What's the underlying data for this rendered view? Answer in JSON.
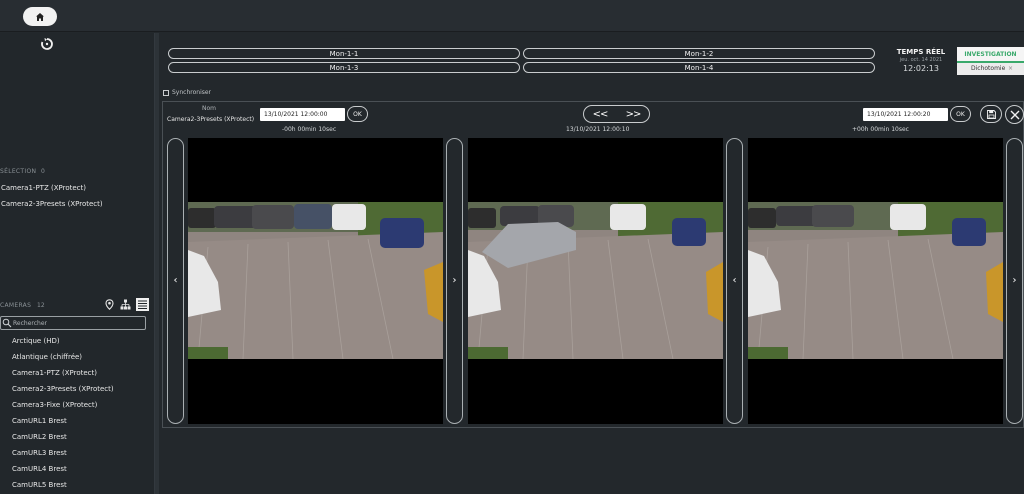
{
  "topbar": {
    "home_icon": "home-icon"
  },
  "sidebar": {
    "reset_icon": "reset-icon",
    "selection": {
      "label": "SÉLECTION",
      "count": "0",
      "items": [
        "Camera1-PTZ (XProtect)",
        "Camera2-3Presets (XProtect)"
      ]
    },
    "cameras": {
      "label": "CAMERAS",
      "count": "12",
      "tool_icons": [
        "map-pin-icon",
        "tree-icon",
        "list-icon"
      ],
      "search_placeholder": "Rechercher",
      "items": [
        "Arctique (HD)",
        "Atlantique (chiffrée)",
        "Camera1-PTZ (XProtect)",
        "Camera2-3Presets (XProtect)",
        "Camera3-Fixe (XProtect)",
        "CamURL1 Brest",
        "CamURL2 Brest",
        "CamURL3 Brest",
        "CamURL4 Brest",
        "CamURL5 Brest"
      ]
    }
  },
  "monitors": [
    "Mon-1-1",
    "Mon-1-2",
    "Mon-1-3",
    "Mon-1-4"
  ],
  "realtime": {
    "title": "TEMPS RÉEL",
    "date": "jeu. oct. 14 2021",
    "time": "12:02:13"
  },
  "investigation": {
    "title": "INVESTIGATION",
    "tag": "Dichotomie",
    "tag_close": "×"
  },
  "sync": {
    "label": "Synchroniser"
  },
  "viewer": {
    "nom_label": "Nom",
    "camera_name": "Camera2-3Presets (XProtect)",
    "start_date": "13/10/2021 12:00:00",
    "end_date": "13/10/2021 12:00:20",
    "ok_label": "OK",
    "step_back": "<<",
    "step_forward": ">>",
    "offset_minus": "-00h 00min 10sec",
    "center_time": "13/10/2021 12:00:10",
    "offset_plus": "+00h 00min 10sec",
    "save_icon": "save-icon",
    "close_icon": "close-icon",
    "prev_arrow": "‹",
    "next_arrow": "›"
  },
  "colors": {
    "background": "#23282c",
    "accent": "#3aa96b",
    "border": "#c9ccce"
  }
}
